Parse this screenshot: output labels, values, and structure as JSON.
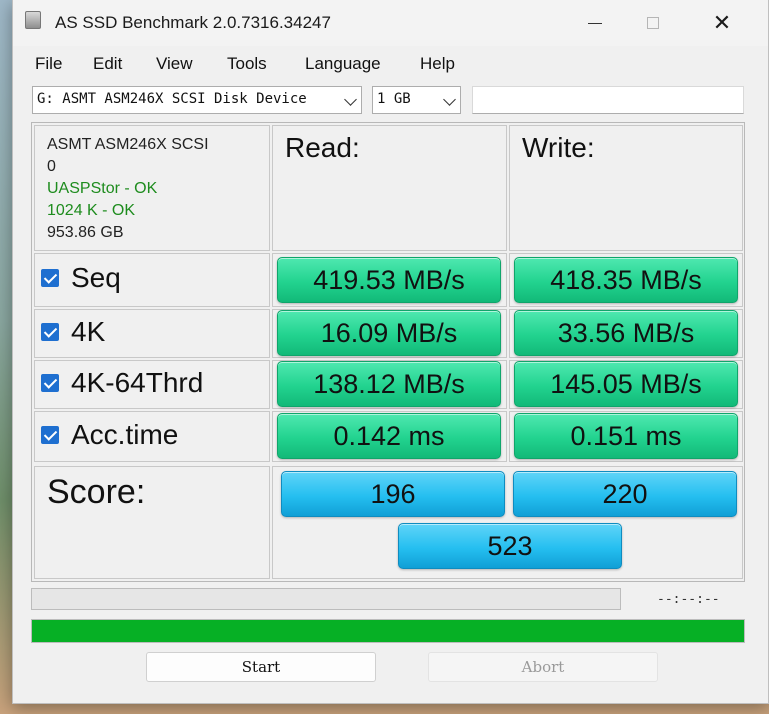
{
  "window": {
    "title": "AS SSD Benchmark 2.0.7316.34247",
    "minimize_glyph": "",
    "close_glyph": "✕"
  },
  "menu": [
    "File",
    "Edit",
    "View",
    "Tools",
    "Language",
    "Help"
  ],
  "toolbar": {
    "drive": "G: ASMT ASM246X SCSI Disk Device",
    "test_size": "1 GB",
    "extra_field": ""
  },
  "drive_info": {
    "name_line1": "ASMT ASM246X SCSI",
    "name_line2": "0",
    "driver_status": "UASPStor - OK",
    "alignment_status": "1024 K - OK",
    "capacity": "953.86 GB"
  },
  "headers": {
    "read": "Read:",
    "write": "Write:"
  },
  "tests": [
    {
      "label": "Seq",
      "checked": true,
      "read": "419.53 MB/s",
      "write": "418.35 MB/s"
    },
    {
      "label": "4K",
      "checked": true,
      "read": "16.09 MB/s",
      "write": "33.56 MB/s"
    },
    {
      "label": "4K-64Thrd",
      "checked": true,
      "read": "138.12 MB/s",
      "write": "145.05 MB/s"
    },
    {
      "label": "Acc.time",
      "checked": true,
      "read": "0.142 ms",
      "write": "0.151 ms"
    }
  ],
  "score": {
    "label": "Score:",
    "read": "196",
    "write": "220",
    "total": "523"
  },
  "progress": {
    "time_readout": "--:--:--",
    "overall_fraction": 1.0
  },
  "buttons": {
    "start": "Start",
    "abort": "Abort"
  },
  "colors": {
    "result_green": "#22d38f",
    "score_blue": "#25bff0",
    "progress_green": "#06b025",
    "ok_text": "#1e8c1e"
  }
}
